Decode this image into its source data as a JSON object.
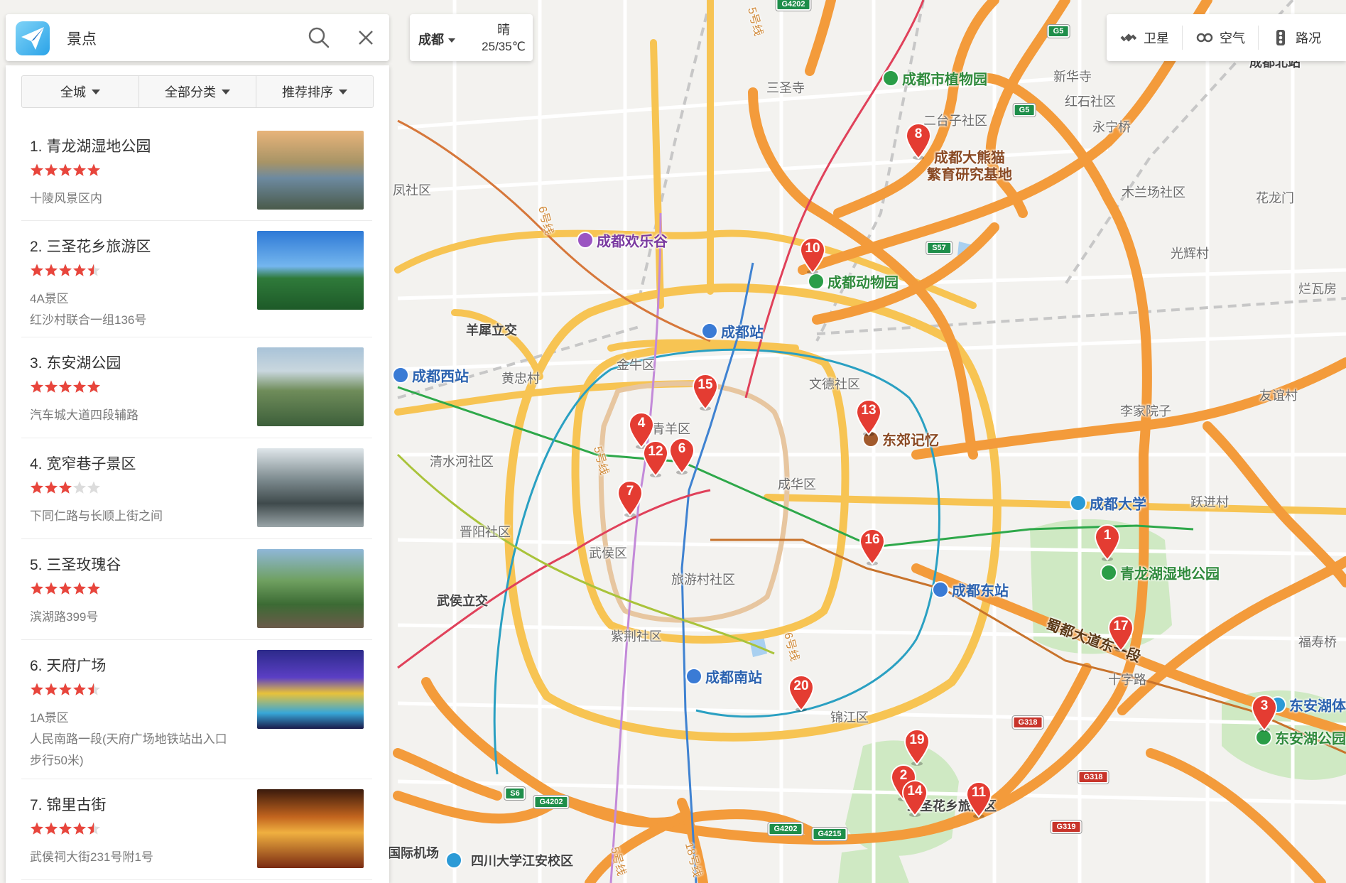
{
  "search": {
    "value": "景点"
  },
  "filters": [
    "全城",
    "全部分类",
    "推荐排序"
  ],
  "weather": {
    "city": "成都",
    "condition": "晴",
    "temperature": "25/35℃"
  },
  "layers": [
    {
      "label": "卫星",
      "icon": "satellite-icon"
    },
    {
      "label": "空气",
      "icon": "air-quality-icon"
    },
    {
      "label": "路况",
      "icon": "traffic-light-icon"
    }
  ],
  "results": [
    {
      "title": "1. 青龙湖湿地公园",
      "rating": 5,
      "lines": [
        "十陵风景区内"
      ]
    },
    {
      "title": "2. 三圣花乡旅游区",
      "rating": 4.5,
      "lines": [
        "4A景区",
        "红沙村联合一组136号"
      ]
    },
    {
      "title": "3. 东安湖公园",
      "rating": 5,
      "lines": [
        "汽车城大道四段辅路"
      ]
    },
    {
      "title": "4. 宽窄巷子景区",
      "rating": 3,
      "lines": [
        "下同仁路与长顺上街之间"
      ]
    },
    {
      "title": "5. 三圣玫瑰谷",
      "rating": 5,
      "lines": [
        "滨湖路399号"
      ]
    },
    {
      "title": "6. 天府广场",
      "rating": 4.5,
      "lines": [
        "1A景区",
        "人民南路一段(天府广场地铁站出入口",
        "步行50米)"
      ]
    },
    {
      "title": "7. 锦里古街",
      "rating": 4.5,
      "lines": [
        "武侯祠大街231号附1号"
      ]
    }
  ],
  "map": {
    "markers": [
      "1",
      "2",
      "3",
      "4",
      "6",
      "7",
      "8",
      "10",
      "11",
      "12",
      "13",
      "14",
      "15",
      "16",
      "17",
      "19",
      "20"
    ],
    "place_labels": {
      "chengdu_zhiwuyuan": "成都市植物园",
      "panda": "成都大熊猫",
      "panda2": "繁育研究基地",
      "huanlegu": "成都欢乐谷",
      "dongwuyuan": "成都动物园",
      "chengduzhan": "成都站",
      "chengduxizhan": "成都西站",
      "dongjiao": "东郊记忆",
      "chengdudaxue": "成都大学",
      "qinglonghu": "青龙湖湿地公园",
      "chengdudongzhan": "成都东站",
      "chengdunanzhan": "成都南站",
      "donganhu": "东安湖公园",
      "donganhuti": "东安湖体",
      "sanshenghuaxiang": "三圣花乡旅游区",
      "sichuandaxue": "四川大学江安校区",
      "jichang": "国际机场",
      "jinniu": "金牛区",
      "qingyang": "青羊区",
      "chenghua": "成华区",
      "wuhou": "武侯区",
      "jinjiang": "锦江区",
      "sanshengsi": "三圣寺",
      "xinhuasi": "新华寺",
      "hongshi": "红石社区",
      "ertaizi": "二台子社区",
      "yongningqiao": "永宁桥",
      "mulanchang": "木兰场社区",
      "hualongmen": "花龙门",
      "guanghuicun": "光辉村",
      "lanwafang": "烂瓦房",
      "xiyanglijiao": "羊犀立交",
      "huangzhongcun": "黄忠村",
      "wende": "文德社区",
      "lijiayuanzi": "李家院子",
      "youyicun": "友谊村",
      "yuejincun": "跃进村",
      "qingshuihe": "清水河社区",
      "jinyang": "晋阳社区",
      "lvyoucun": "旅游村社区",
      "wuhoulijiao": "武侯立交",
      "zijing": "紫荆社区",
      "shuduroad": "蜀都大道东一段",
      "shizilu": "十字路",
      "fushouqiao": "福寿桥",
      "chengdubeizhan": "成都北站",
      "fengshequ": "凤社区",
      "line5a": "5号线",
      "line6a": "6号线",
      "line5b": "5号线",
      "line6b": "6号线",
      "line5c": "5号线",
      "line18": "18号线",
      "line5d": "5号线"
    },
    "shields": [
      "G4202",
      "G5",
      "G5",
      "S57",
      "G318",
      "G318",
      "G319",
      "S6",
      "G4202",
      "G4202",
      "G4215"
    ]
  }
}
